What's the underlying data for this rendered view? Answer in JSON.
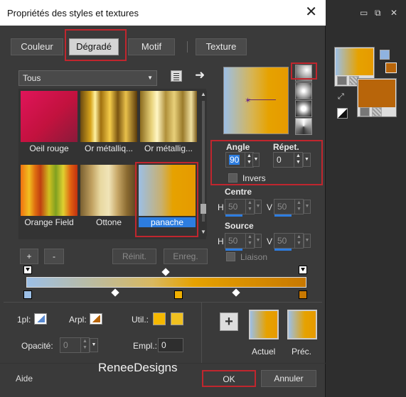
{
  "dialog": {
    "title": "Propriétés des styles et textures",
    "close_glyph": "✕"
  },
  "tabs": [
    {
      "label": "Couleur",
      "active": false
    },
    {
      "label": "Dégradé",
      "active": true
    },
    {
      "label": "Motif",
      "active": false
    },
    {
      "label": "Texture",
      "active": false
    }
  ],
  "category_select": {
    "value": "Tous"
  },
  "gradients": [
    {
      "label": "Oeil rouge"
    },
    {
      "label": "Or métalliq..."
    },
    {
      "label": "Or métallig..."
    },
    {
      "label": "Orange Field"
    },
    {
      "label": "Ottone"
    },
    {
      "label": "panache",
      "selected": true
    }
  ],
  "list_buttons": {
    "add": "+",
    "remove": "-",
    "reset": "Réinit.",
    "save": "Enreg."
  },
  "angle": {
    "label": "Angle",
    "value": "90"
  },
  "repeat": {
    "label": "Répet.",
    "value": "0"
  },
  "invert": {
    "label": "Invers",
    "checked": false
  },
  "center": {
    "label": "Centre",
    "h_label": "H",
    "h_value": "50",
    "v_label": "V",
    "v_value": "50"
  },
  "source": {
    "label": "Source",
    "h_label": "H",
    "h_value": "50",
    "v_label": "V",
    "v_value": "50"
  },
  "link": {
    "label": "Liaison",
    "checked": false
  },
  "stop_props": {
    "pl_label": "1pl:",
    "arpl_label": "Arpl:",
    "util_label": "Util.:",
    "opacity_label": "Opacité:",
    "opacity_value": "0",
    "empl_label": "Empl.:",
    "empl_value": "0"
  },
  "preview": {
    "current_label": "Actuel",
    "previous_label": "Préc."
  },
  "footer": {
    "help": "Aide",
    "watermark": "ReneeDesigns",
    "ok": "OK",
    "cancel": "Annuler"
  },
  "bg_window": {
    "minimize": "▭",
    "restore": "⧉",
    "close": "✕"
  },
  "colors": {
    "accent_red": "#c0262e",
    "selection_blue": "#2d7de0",
    "gradient_start": "#9cbfe6",
    "gradient_end": "#e69a00"
  }
}
